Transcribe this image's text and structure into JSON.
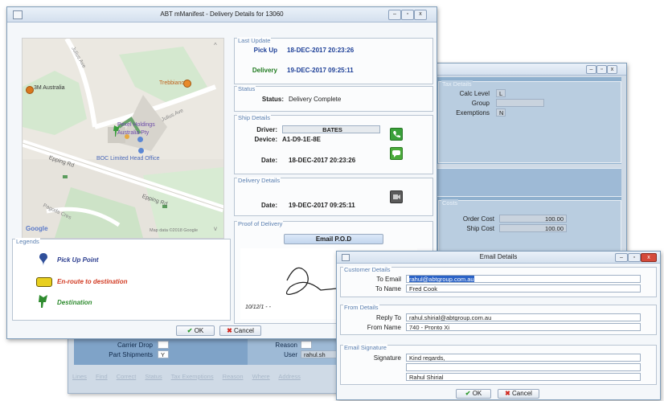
{
  "delivery_window": {
    "title": "ABT mManifest - Delivery Details for 13060",
    "map": {
      "labels": {
        "3m": "3M Australia",
        "trebbiano": "Trebbiano",
        "pexel": "Pexel Holdings",
        "pexel2": "Australia Pty",
        "boc": "BOC Limited Head Office",
        "epping_rd": "Epping Rd",
        "epping_rd2": "Epping Rd",
        "juliett_st": "Julius Ave",
        "julius_ave": "Julius Ave",
        "pagoda": "Pagoda Cres",
        "google": "Google",
        "map_data": "Map data ©2018 Google"
      }
    },
    "legends": {
      "title": "Legends",
      "pickup": "Pick Up Point",
      "enroute": "En-route to destination",
      "destination": "Destination"
    },
    "last_update": {
      "title": "Last Update",
      "pickup_label": "Pick Up",
      "pickup_value": "18-DEC-2017 20:23:26",
      "delivery_label": "Delivery",
      "delivery_value": "19-DEC-2017 09:25:11"
    },
    "status": {
      "title": "Status",
      "label": "Status:",
      "value": "Delivery Complete"
    },
    "ship_details": {
      "title": "Ship Details",
      "driver_label": "Driver:",
      "driver_value": "BATES",
      "device_label": "Device:",
      "device_value": "A1-D9-1E-8E",
      "date_label": "Date:",
      "date_value": "18-DEC-2017 20:23:26"
    },
    "delivery_details": {
      "title": "Delivery Details",
      "date_label": "Date:",
      "date_value": "19-DEC-2017 09:25:11"
    },
    "pod": {
      "title": "Proof of Delivery",
      "email_button": "Email P.O.D",
      "sig_text": "10/12/1 - -"
    },
    "ok_label": "OK",
    "cancel_label": "Cancel"
  },
  "background_window": {
    "tax": {
      "title": "Tax Details",
      "calc_level_label": "Calc Level",
      "calc_level_value": "L",
      "group_label": "Group",
      "exemptions_label": "Exemptions",
      "exemptions_value": "N"
    },
    "costs": {
      "title": "Costs",
      "order_cost_label": "Order Cost",
      "order_cost_value": "100.00",
      "ship_cost_label": "Ship Cost",
      "ship_cost_value": "100.00"
    },
    "carrier_drop_label": "Carrier Drop",
    "part_shipments_label": "Part Shipments",
    "part_shipments_value": "Y",
    "reason_label": "Reason",
    "user_label": "User",
    "user_value": "rahul.sh",
    "menu": [
      "Lines",
      "Find",
      "Correct",
      "Status",
      "Tax Exemptions",
      "Reason",
      "Where",
      "Address"
    ]
  },
  "email_window": {
    "title": "Email Details",
    "customer": {
      "title": "Customer Details",
      "to_email_label": "To Email",
      "to_email_value": "rahul@abtgroup.com.au",
      "to_name_label": "To Name",
      "to_name_value": "Fred Cook"
    },
    "from": {
      "title": "From Details",
      "reply_to_label": "Reply To",
      "reply_to_value": "rahul.shirial@abtgroup.com.au",
      "from_name_label": "From Name",
      "from_name_value": "740 - Pronto Xi"
    },
    "signature": {
      "title": "Email Signature",
      "label": "Signature",
      "line1": "Kind regards,",
      "line2": "",
      "line3": "Rahul Shirial"
    },
    "ok_label": "OK",
    "cancel_label": "Cancel"
  }
}
